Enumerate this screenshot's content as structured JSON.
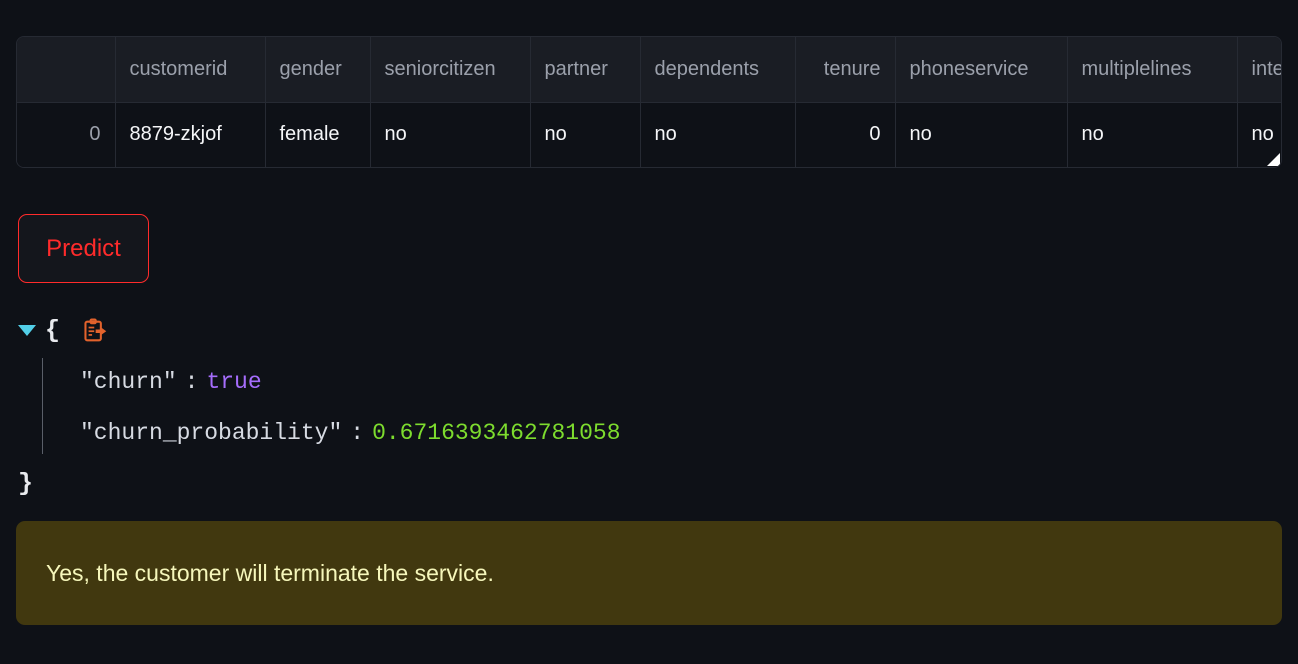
{
  "dataframe": {
    "columns": [
      {
        "key": "index",
        "label": "",
        "align": "right"
      },
      {
        "key": "customerid",
        "label": "customerid",
        "align": "left"
      },
      {
        "key": "gender",
        "label": "gender",
        "align": "left"
      },
      {
        "key": "seniorcitizen",
        "label": "seniorcitizen",
        "align": "left"
      },
      {
        "key": "partner",
        "label": "partner",
        "align": "left"
      },
      {
        "key": "dependents",
        "label": "dependents",
        "align": "left"
      },
      {
        "key": "tenure",
        "label": "tenure",
        "align": "right"
      },
      {
        "key": "phoneservice",
        "label": "phoneservice",
        "align": "left"
      },
      {
        "key": "multiplelines",
        "label": "multiplelines",
        "align": "left"
      },
      {
        "key": "internetservice",
        "label": "inte",
        "align": "left"
      }
    ],
    "rows": [
      {
        "index": "0",
        "customerid": "8879-zkjof",
        "gender": "female",
        "seniorcitizen": "no",
        "partner": "no",
        "dependents": "no",
        "tenure": "0",
        "phoneservice": "no",
        "multiplelines": "no",
        "internetservice": "no"
      }
    ],
    "resize_handle": "resize-handle"
  },
  "actions": {
    "predict_label": "Predict",
    "predict_color": "#ff2b2b"
  },
  "json_output": {
    "open_brace": "{",
    "close_brace": "}",
    "toggle_icon": "caret-down-icon",
    "toggle_color": "#52cfe8",
    "copy_icon": "clipboard-copy-icon",
    "copy_icon_color": "#e2622c",
    "entries": [
      {
        "key": "\"churn\"",
        "colon": ":",
        "value": "true",
        "value_type": "bool"
      },
      {
        "key": "\"churn_probability\"",
        "colon": ":",
        "value": "0.6716393462781058",
        "value_type": "number"
      }
    ],
    "bool_color": "#a56dfc",
    "number_color": "#7ddc2e"
  },
  "alert": {
    "message": "Yes, the customer will terminate the service.",
    "background": "#41380f",
    "text_color": "#f6f7bb",
    "kind": "warning"
  }
}
